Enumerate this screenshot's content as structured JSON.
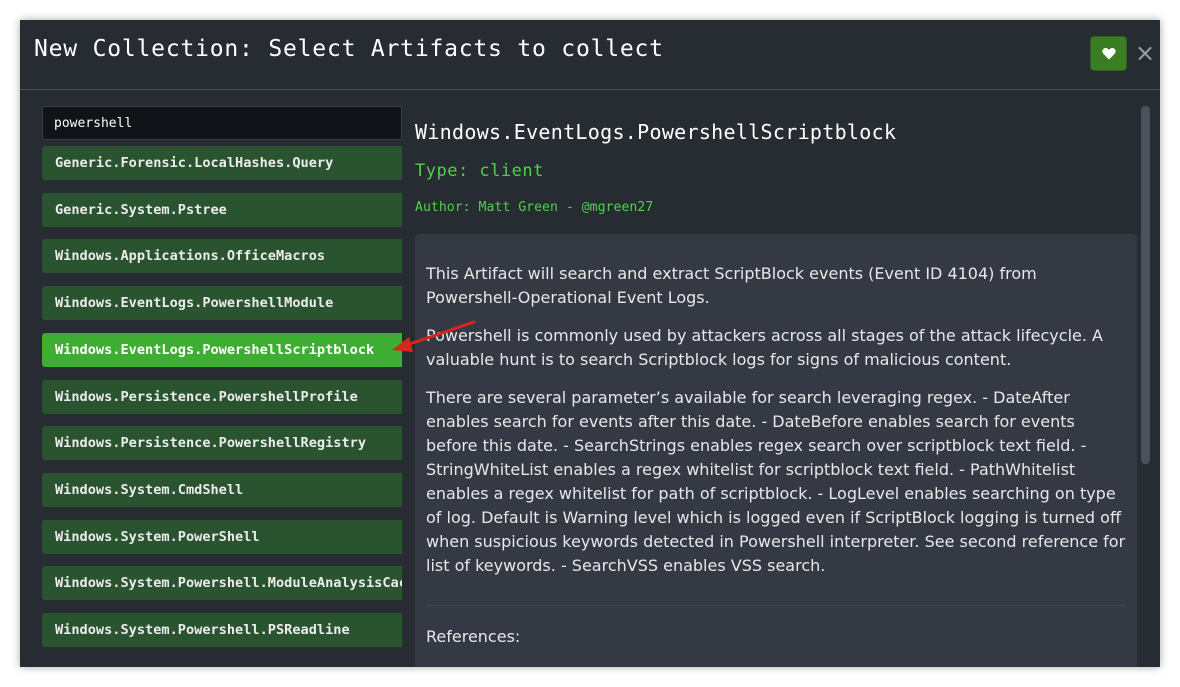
{
  "dialog": {
    "title": "New Collection: Select Artifacts to collect",
    "close_label": "×"
  },
  "search": {
    "value": "powershell"
  },
  "artifacts": [
    {
      "label": "Generic.Forensic.LocalHashes.Query"
    },
    {
      "label": "Generic.System.Pstree"
    },
    {
      "label": "Windows.Applications.OfficeMacros"
    },
    {
      "label": "Windows.EventLogs.PowershellModule"
    },
    {
      "label": "Windows.EventLogs.PowershellScriptblock",
      "selected": true
    },
    {
      "label": "Windows.Persistence.PowershellProfile"
    },
    {
      "label": "Windows.Persistence.PowershellRegistry"
    },
    {
      "label": "Windows.System.CmdShell"
    },
    {
      "label": "Windows.System.PowerShell"
    },
    {
      "label": "Windows.System.Powershell.ModuleAnalysisCache"
    },
    {
      "label": "Windows.System.Powershell.PSReadline"
    }
  ],
  "details": {
    "name": "Windows.EventLogs.PowershellScriptblock",
    "type": "Type: client",
    "author": "Author: Matt Green - @mgreen27",
    "description": [
      "This Artifact will search and extract ScriptBlock events (Event ID 4104) from Powershell-Operational Event Logs.",
      "Powershell is commonly used by attackers across all stages of the attack lifecycle. A valuable hunt is to search Scriptblock logs for signs of malicious content.",
      "There are several parameter’s available for search leveraging regex. - DateAfter enables search for events after this date. - DateBefore enables search for events before this date. - SearchStrings enables regex search over scriptblock text field. - StringWhiteList enables a regex whitelist for scriptblock text field. - PathWhitelist enables a regex whitelist for path of scriptblock. - LogLevel enables searching on type of log. Default is Warning level which is logged even if ScriptBlock logging is turned off when suspicious keywords detected in Powershell interpreter. See second reference for list of keywords. - SearchVSS enables VSS search."
    ],
    "references_label": "References:"
  },
  "icons": {
    "favorite": "heart-icon",
    "close": "close-icon",
    "annotation": "red-arrow"
  },
  "colors": {
    "background": "#272c33",
    "item": "#2a5330",
    "selected_item": "#3dae31",
    "accent_text": "#4fd14a",
    "favorite_button": "#3a7d22",
    "arrow": "#d9261c"
  }
}
